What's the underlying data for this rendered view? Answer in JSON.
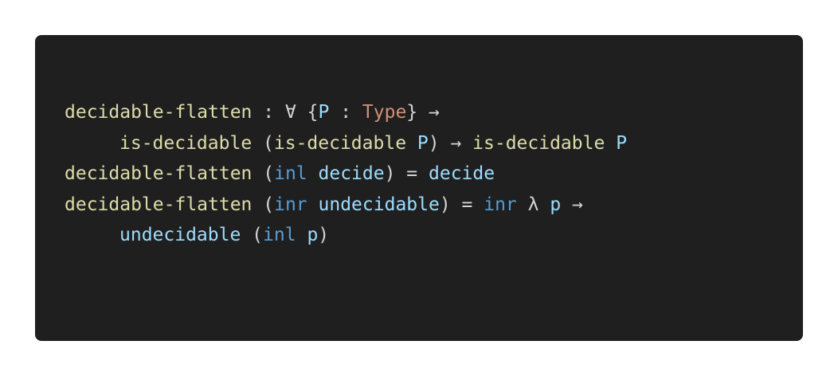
{
  "lines": [
    {
      "indent": false,
      "tokens": [
        {
          "text": "decidable-flatten",
          "kind": "fn"
        },
        {
          "text": " : ∀ {",
          "kind": "op"
        },
        {
          "text": "P",
          "kind": "var"
        },
        {
          "text": " : ",
          "kind": "op"
        },
        {
          "text": "Type",
          "kind": "ty"
        },
        {
          "text": "} →",
          "kind": "op"
        }
      ]
    },
    {
      "indent": true,
      "tokens": [
        {
          "text": "is-decidable",
          "kind": "fn"
        },
        {
          "text": " (",
          "kind": "op"
        },
        {
          "text": "is-decidable",
          "kind": "fn"
        },
        {
          "text": " ",
          "kind": "op"
        },
        {
          "text": "P",
          "kind": "var"
        },
        {
          "text": ") → ",
          "kind": "op"
        },
        {
          "text": "is-decidable",
          "kind": "fn"
        },
        {
          "text": " ",
          "kind": "op"
        },
        {
          "text": "P",
          "kind": "var"
        }
      ]
    },
    {
      "indent": false,
      "tokens": [
        {
          "text": "decidable-flatten",
          "kind": "fn"
        },
        {
          "text": " (",
          "kind": "op"
        },
        {
          "text": "inl",
          "kind": "kw"
        },
        {
          "text": " ",
          "kind": "op"
        },
        {
          "text": "decide",
          "kind": "var"
        },
        {
          "text": ") = ",
          "kind": "op"
        },
        {
          "text": "decide",
          "kind": "var"
        }
      ]
    },
    {
      "indent": false,
      "tokens": [
        {
          "text": "decidable-flatten",
          "kind": "fn"
        },
        {
          "text": " (",
          "kind": "op"
        },
        {
          "text": "inr",
          "kind": "kw"
        },
        {
          "text": " ",
          "kind": "op"
        },
        {
          "text": "undecidable",
          "kind": "var"
        },
        {
          "text": ") = ",
          "kind": "op"
        },
        {
          "text": "inr",
          "kind": "kw"
        },
        {
          "text": " λ ",
          "kind": "op"
        },
        {
          "text": "p",
          "kind": "var"
        },
        {
          "text": " →",
          "kind": "op"
        }
      ]
    },
    {
      "indent": true,
      "tokens": [
        {
          "text": "undecidable",
          "kind": "var"
        },
        {
          "text": " (",
          "kind": "op"
        },
        {
          "text": "inl",
          "kind": "kw"
        },
        {
          "text": " ",
          "kind": "op"
        },
        {
          "text": "p",
          "kind": "var"
        },
        {
          "text": ")",
          "kind": "op"
        }
      ]
    }
  ],
  "colors": {
    "background": "#1f1f1f",
    "function": "#dcdcaa",
    "variable": "#9cdcfe",
    "keyword": "#569cd6",
    "type": "#ce9178",
    "punctuation": "#d4d4d4"
  }
}
